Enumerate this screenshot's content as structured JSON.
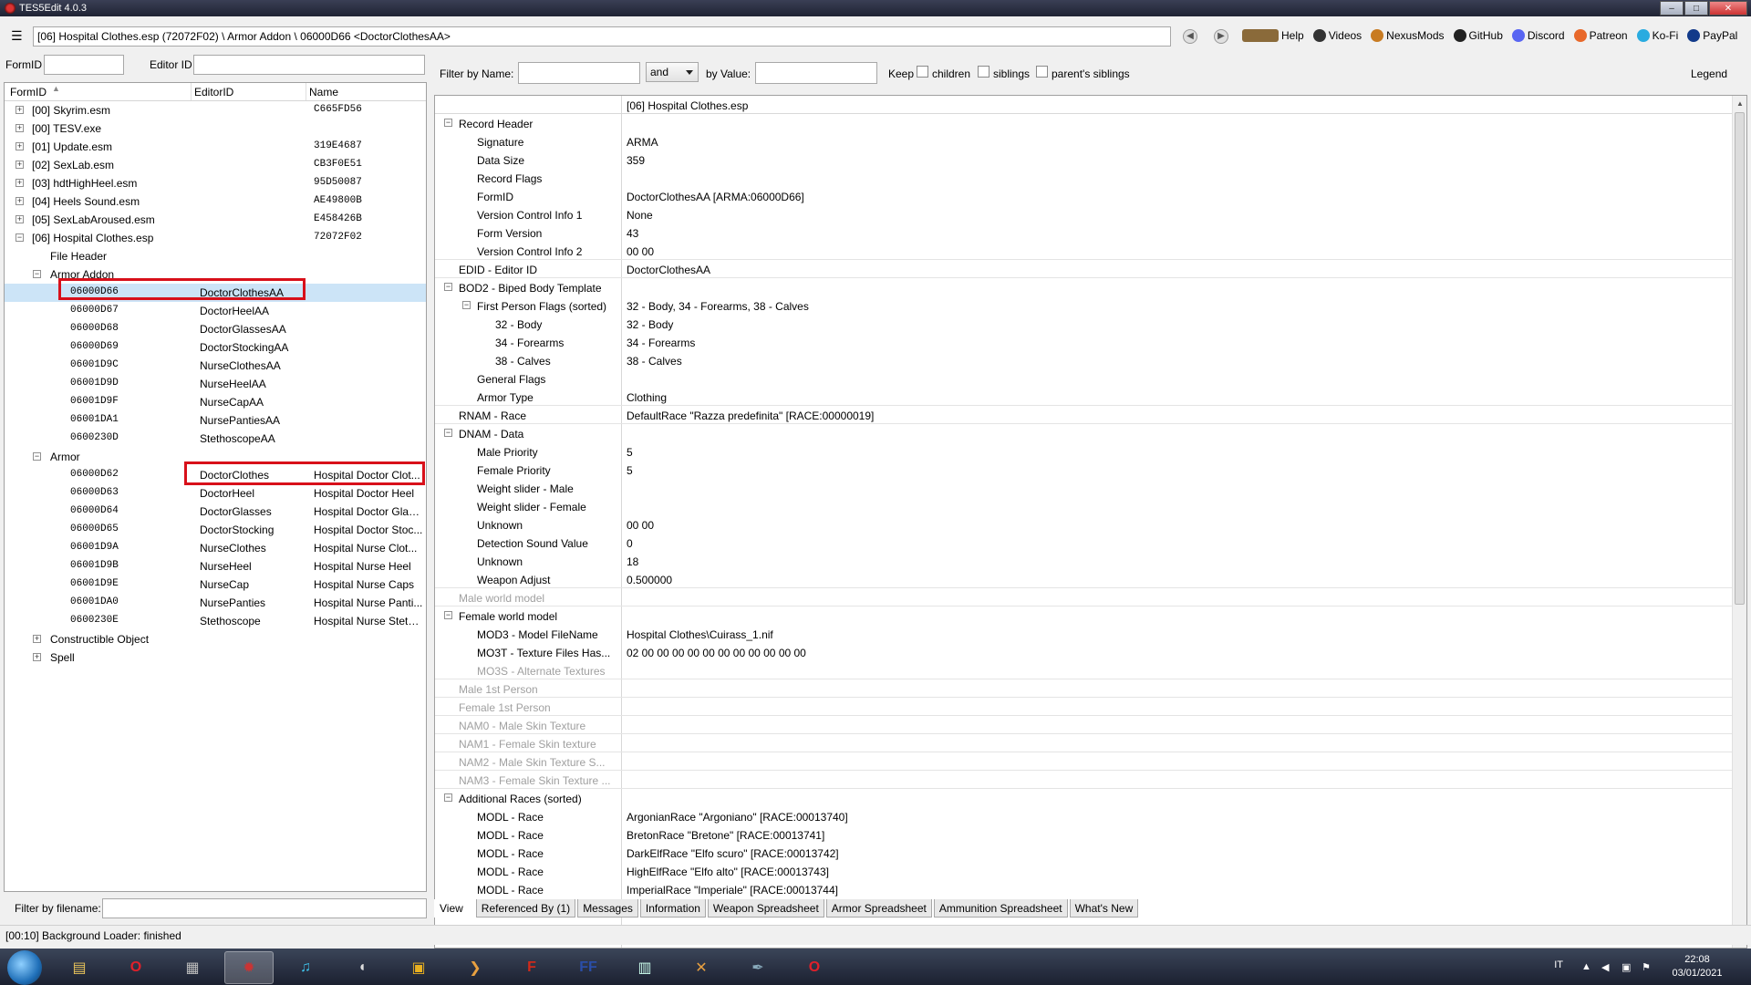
{
  "window": {
    "title": "TES5Edit 4.0.3",
    "minimize": "–",
    "maximize": "□",
    "close": "✕"
  },
  "toolbar": {
    "path": "[06] Hospital Clothes.esp (72072F02) \\ Armor Addon \\ 06000D66 <DoctorClothesAA>",
    "links": [
      {
        "label": "Help",
        "icon": "book-icon",
        "color": "#8a6a3a"
      },
      {
        "label": "Videos",
        "icon": "video-icon",
        "color": "#333"
      },
      {
        "label": "NexusMods",
        "icon": "nexus-icon",
        "color": "#c87b22"
      },
      {
        "label": "GitHub",
        "icon": "github-icon",
        "color": "#222"
      },
      {
        "label": "Discord",
        "icon": "discord-icon",
        "color": "#5865f2"
      },
      {
        "label": "Patreon",
        "icon": "patreon-icon",
        "color": "#e8682a"
      },
      {
        "label": "Ko-Fi",
        "icon": "kofi-icon",
        "color": "#29abe0"
      },
      {
        "label": "PayPal",
        "icon": "paypal-icon",
        "color": "#123a8a"
      }
    ]
  },
  "left_filter": {
    "formid_label": "FormID",
    "editorid_label": "Editor ID"
  },
  "tree": {
    "headers": {
      "formid": "FormID",
      "editorid": "EditorID",
      "name": "Name"
    },
    "files": [
      {
        "label": "[00] Skyrim.esm",
        "name": "C665FD56"
      },
      {
        "label": "[00] TESV.exe",
        "name": ""
      },
      {
        "label": "[01] Update.esm",
        "name": "319E4687"
      },
      {
        "label": "[02] SexLab.esm",
        "name": "CB3F0E51"
      },
      {
        "label": "[03] hdtHighHeel.esm",
        "name": "95D50087"
      },
      {
        "label": "[04] Heels Sound.esm",
        "name": "AE49800B"
      },
      {
        "label": "[05] SexLabAroused.esm",
        "name": "E458426B"
      },
      {
        "label": "[06] Hospital Clothes.esp",
        "name": "72072F02"
      }
    ],
    "file_header": "File Header",
    "armor_addon_group": "Armor Addon",
    "armor_addon": [
      {
        "formid": "06000D66",
        "editorid": "DoctorClothesAA",
        "name": ""
      },
      {
        "formid": "06000D67",
        "editorid": "DoctorHeelAA",
        "name": ""
      },
      {
        "formid": "06000D68",
        "editorid": "DoctorGlassesAA",
        "name": ""
      },
      {
        "formid": "06000D69",
        "editorid": "DoctorStockingAA",
        "name": ""
      },
      {
        "formid": "06001D9C",
        "editorid": "NurseClothesAA",
        "name": ""
      },
      {
        "formid": "06001D9D",
        "editorid": "NurseHeelAA",
        "name": ""
      },
      {
        "formid": "06001D9F",
        "editorid": "NurseCapAA",
        "name": ""
      },
      {
        "formid": "06001DA1",
        "editorid": "NursePantiesAA",
        "name": ""
      },
      {
        "formid": "0600230D",
        "editorid": "StethoscopeAA",
        "name": ""
      }
    ],
    "armor_group": "Armor",
    "armor": [
      {
        "formid": "06000D62",
        "editorid": "DoctorClothes",
        "name": "Hospital Doctor Clot..."
      },
      {
        "formid": "06000D63",
        "editorid": "DoctorHeel",
        "name": "Hospital Doctor Heel"
      },
      {
        "formid": "06000D64",
        "editorid": "DoctorGlasses",
        "name": "Hospital Doctor Glas..."
      },
      {
        "formid": "06000D65",
        "editorid": "DoctorStocking",
        "name": "Hospital Doctor Stoc..."
      },
      {
        "formid": "06001D9A",
        "editorid": "NurseClothes",
        "name": "Hospital Nurse Clot..."
      },
      {
        "formid": "06001D9B",
        "editorid": "NurseHeel",
        "name": "Hospital Nurse Heel"
      },
      {
        "formid": "06001D9E",
        "editorid": "NurseCap",
        "name": "Hospital Nurse Caps"
      },
      {
        "formid": "06001DA0",
        "editorid": "NursePanties",
        "name": "Hospital Nurse Panti..."
      },
      {
        "formid": "0600230E",
        "editorid": "Stethoscope",
        "name": "Hospital Nurse Steth..."
      }
    ],
    "other_groups": [
      "Constructible Object",
      "Spell"
    ]
  },
  "filename_filter": {
    "label": "Filter by filename:"
  },
  "right_filter": {
    "by_name": "Filter by Name:",
    "op": "and",
    "by_value": "by Value:",
    "keep": "Keep",
    "children": "children",
    "siblings": "siblings",
    "parents_siblings": "parent's siblings",
    "legend": "Legend"
  },
  "grid": {
    "column_header": "[06] Hospital Clothes.esp",
    "rows": [
      {
        "label": "Record Header",
        "value": "",
        "level": 0,
        "exp": "−"
      },
      {
        "label": "Signature",
        "value": "ARMA",
        "level": 1
      },
      {
        "label": "Data Size",
        "value": "359",
        "level": 1
      },
      {
        "label": "Record Flags",
        "value": "",
        "level": 1
      },
      {
        "label": "FormID",
        "value": "DoctorClothesAA [ARMA:06000D66]",
        "level": 1
      },
      {
        "label": "Version Control Info 1",
        "value": "None",
        "level": 1
      },
      {
        "label": "Form Version",
        "value": "43",
        "level": 1
      },
      {
        "label": "Version Control Info 2",
        "value": "00 00",
        "level": 1,
        "sep": true
      },
      {
        "label": "EDID - Editor ID",
        "value": "DoctorClothesAA",
        "level": 0,
        "sep": true
      },
      {
        "label": "BOD2 - Biped Body Template",
        "value": "",
        "level": 0,
        "exp": "−"
      },
      {
        "label": "First Person Flags (sorted)",
        "value": "32 - Body, 34 - Forearms, 38 - Calves",
        "level": 1,
        "exp": "−"
      },
      {
        "label": "32 - Body",
        "value": "32 - Body",
        "level": 2
      },
      {
        "label": "34 - Forearms",
        "value": "34 - Forearms",
        "level": 2
      },
      {
        "label": "38 - Calves",
        "value": "38 - Calves",
        "level": 2
      },
      {
        "label": "General Flags",
        "value": "",
        "level": 1
      },
      {
        "label": "Armor Type",
        "value": "Clothing",
        "level": 1,
        "sep": true
      },
      {
        "label": "RNAM - Race",
        "value": "DefaultRace \"Razza predefinita\" [RACE:00000019]",
        "level": 0,
        "sep": true
      },
      {
        "label": "DNAM - Data",
        "value": "",
        "level": 0,
        "exp": "−"
      },
      {
        "label": "Male Priority",
        "value": "5",
        "level": 1
      },
      {
        "label": "Female Priority",
        "value": "5",
        "level": 1
      },
      {
        "label": "Weight slider - Male",
        "value": "",
        "level": 1
      },
      {
        "label": "Weight slider - Female",
        "value": "",
        "level": 1
      },
      {
        "label": "Unknown",
        "value": "00 00",
        "level": 1
      },
      {
        "label": "Detection Sound Value",
        "value": "0",
        "level": 1
      },
      {
        "label": "Unknown",
        "value": "18",
        "level": 1
      },
      {
        "label": "Weapon Adjust",
        "value": "0.500000",
        "level": 1,
        "sep": true
      },
      {
        "label": "Male world model",
        "value": "",
        "level": 0,
        "disabled": true,
        "sep": true
      },
      {
        "label": "Female world model",
        "value": "",
        "level": 0,
        "exp": "−"
      },
      {
        "label": "MOD3 - Model FileName",
        "value": "Hospital Clothes\\Cuirass_1.nif",
        "level": 1
      },
      {
        "label": "MO3T - Texture Files Has...",
        "value": "02 00 00 00 00 00 00 00 00 00 00 00",
        "level": 1
      },
      {
        "label": "MO3S - Alternate Textures",
        "value": "",
        "level": 1,
        "disabled": true,
        "sep": true
      },
      {
        "label": "Male 1st Person",
        "value": "",
        "level": 0,
        "disabled": true,
        "sep": true
      },
      {
        "label": "Female 1st Person",
        "value": "",
        "level": 0,
        "disabled": true,
        "sep": true
      },
      {
        "label": "NAM0 - Male Skin Texture",
        "value": "",
        "level": 0,
        "disabled": true,
        "sep": true
      },
      {
        "label": "NAM1 - Female Skin texture",
        "value": "",
        "level": 0,
        "disabled": true,
        "sep": true
      },
      {
        "label": "NAM2 - Male Skin Texture S...",
        "value": "",
        "level": 0,
        "disabled": true,
        "sep": true
      },
      {
        "label": "NAM3 - Female Skin Texture ...",
        "value": "",
        "level": 0,
        "disabled": true,
        "sep": true
      },
      {
        "label": "Additional Races (sorted)",
        "value": "",
        "level": 0,
        "exp": "−"
      },
      {
        "label": "MODL - Race",
        "value": "ArgonianRace \"Argoniano\" [RACE:00013740]",
        "level": 1
      },
      {
        "label": "MODL - Race",
        "value": "BretonRace \"Bretone\" [RACE:00013741]",
        "level": 1
      },
      {
        "label": "MODL - Race",
        "value": "DarkElfRace \"Elfo scuro\" [RACE:00013742]",
        "level": 1
      },
      {
        "label": "MODL - Race",
        "value": "HighElfRace \"Elfo alto\" [RACE:00013743]",
        "level": 1
      },
      {
        "label": "MODL - Race",
        "value": "ImperialRace \"Imperiale\" [RACE:00013744]",
        "level": 1
      }
    ]
  },
  "tabs": [
    "View",
    "Referenced By (1)",
    "Messages",
    "Information",
    "Weapon Spreadsheet",
    "Armor Spreadsheet",
    "Ammunition Spreadsheet",
    "What's New"
  ],
  "status": "[00:10] Background Loader: finished",
  "taskbar": {
    "icons": [
      {
        "name": "explorer-icon",
        "glyph": "▤",
        "color": "#e8c35a"
      },
      {
        "name": "opera-icon",
        "glyph": "O",
        "color": "#e0202a"
      },
      {
        "name": "media-icon",
        "glyph": "▦",
        "color": "#bbb"
      },
      {
        "name": "tes5edit-icon",
        "glyph": "✹",
        "color": "#c33"
      },
      {
        "name": "music-icon",
        "glyph": "♫",
        "color": "#3fc0e8"
      },
      {
        "name": "audio-icon",
        "glyph": "◖",
        "color": "#ddd"
      },
      {
        "name": "notes-icon",
        "glyph": "▣",
        "color": "#e8b020"
      },
      {
        "name": "terminal-icon",
        "glyph": "❯",
        "color": "#e8a040"
      },
      {
        "name": "filezilla-icon",
        "glyph": "F",
        "color": "#d02a1a"
      },
      {
        "name": "ffdec-icon",
        "glyph": "FF",
        "color": "#2a4ea8"
      },
      {
        "name": "window-icon",
        "glyph": "▥",
        "color": "#cfe"
      },
      {
        "name": "tools-icon",
        "glyph": "✕",
        "color": "#e8a040"
      },
      {
        "name": "pen-icon",
        "glyph": "✒",
        "color": "#8ab"
      },
      {
        "name": "opera-gx-icon",
        "glyph": "O",
        "color": "#e0202a"
      }
    ],
    "lang": "IT",
    "time": "22:08",
    "date": "03/01/2021"
  }
}
